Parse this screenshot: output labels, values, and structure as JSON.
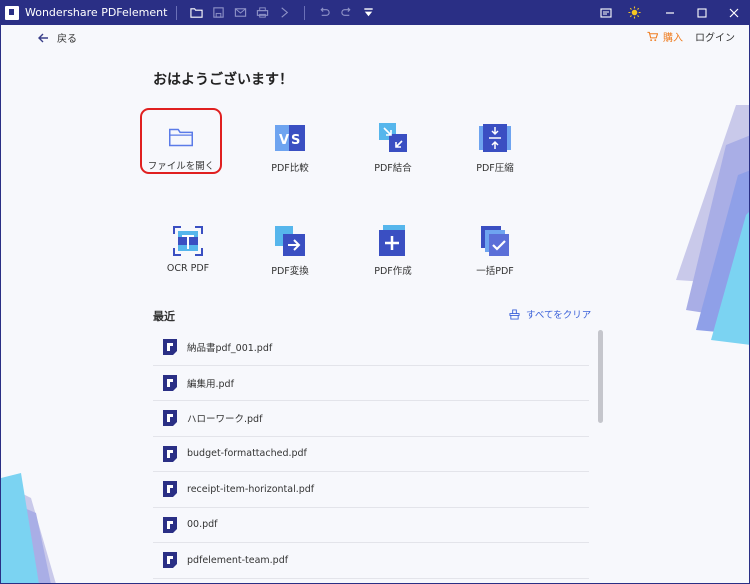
{
  "app": {
    "title": "Wondershare PDFelement"
  },
  "titlebar": {
    "icons": [
      "folder-open-icon",
      "save-icon",
      "mail-icon",
      "print-icon",
      "arrow-right-icon",
      "undo-icon",
      "redo-icon",
      "quick-menu-icon"
    ],
    "right_icons": [
      "feedback-icon",
      "theme-sun-icon"
    ],
    "window_buttons": [
      "minimize-icon",
      "maximize-icon",
      "close-icon"
    ]
  },
  "header": {
    "back_label": "戻る",
    "buy_label": "購入",
    "login_label": "ログイン"
  },
  "main": {
    "greeting": "おはようございます！",
    "tools": [
      {
        "label": "ファイルを開く",
        "icon": "open-file-icon",
        "selected": true
      },
      {
        "label": "PDF比較",
        "icon": "compare-pdf-icon"
      },
      {
        "label": "PDF結合",
        "icon": "combine-pdf-icon"
      },
      {
        "label": "PDF圧縮",
        "icon": "compress-pdf-icon"
      },
      {
        "label": "OCR PDF",
        "icon": "ocr-icon"
      },
      {
        "label": "PDF変換",
        "icon": "convert-pdf-icon"
      },
      {
        "label": "PDF作成",
        "icon": "create-pdf-icon"
      },
      {
        "label": "一括PDF",
        "icon": "batch-pdf-icon"
      }
    ]
  },
  "recent": {
    "title": "最近",
    "clear_label": "すべてをクリア",
    "files": [
      "納品書pdf_001.pdf",
      "編集用.pdf",
      "ハローワーク.pdf",
      "budget-formattached.pdf",
      "receipt-item-horizontal.pdf",
      "00.pdf",
      "pdfelement-team.pdf"
    ]
  },
  "colors": {
    "titlebar": "#2a2f85",
    "accent": "#3c62d9",
    "buy": "#ef7d21",
    "selected_border": "#e02020",
    "background": "#f7f8fc"
  }
}
